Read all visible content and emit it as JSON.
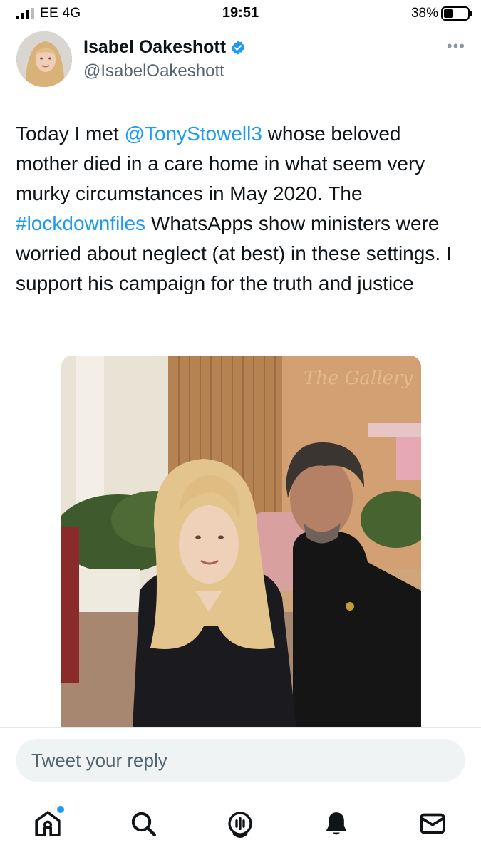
{
  "status_bar": {
    "carrier": "EE  4G",
    "time": "19:51",
    "battery_percent": "38%",
    "signal_bars": 3
  },
  "tweet": {
    "display_name": "Isabel Oakeshott",
    "handle": "@IsabelOakeshott",
    "verified": true,
    "more_icon": "more-horizontal-icon",
    "text_parts": {
      "p1": "Today I met ",
      "mention": "@TonyStowell3",
      "p2": " whose beloved mother died in a care home in what seem very murky circumstances in May 2020. The ",
      "hashtag": "#lockdownfiles",
      "p3": " WhatsApps show ministers were worried about neglect (at best) in these settings. I support his campaign for the truth and justice"
    }
  },
  "reply": {
    "placeholder": "Tweet your reply"
  },
  "nav": {
    "items": [
      {
        "icon": "home-icon",
        "has_notification_dot": true
      },
      {
        "icon": "search-icon"
      },
      {
        "icon": "spaces-icon"
      },
      {
        "icon": "notifications-bell-icon"
      },
      {
        "icon": "messages-envelope-icon"
      }
    ]
  },
  "colors": {
    "accent": "#1d9bf0",
    "text_primary": "#0f1419",
    "text_secondary": "#536471"
  }
}
